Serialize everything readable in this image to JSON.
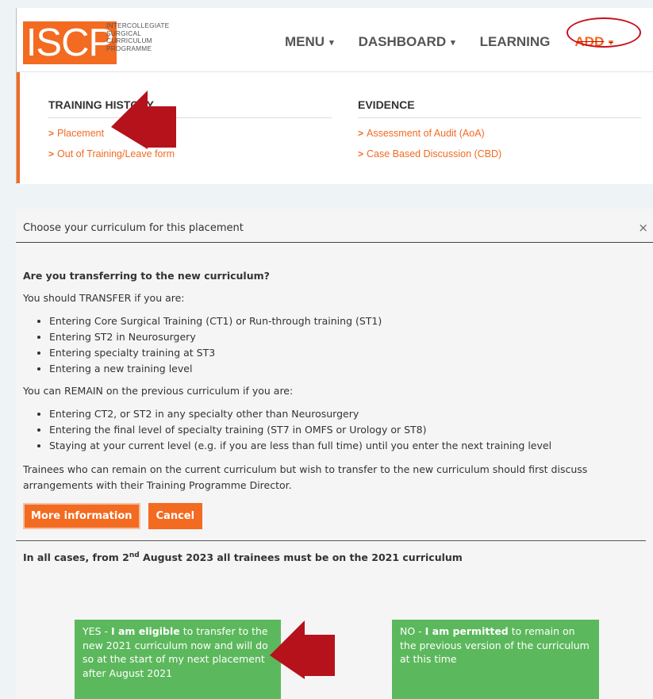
{
  "logo": {
    "short": "ISCP",
    "line1": "INTERCOLLEGIATE",
    "line2": "SURGICAL",
    "line3": "CURRICULUM",
    "line4": "PROGRAMME"
  },
  "nav": {
    "menu": "MENU",
    "dashboard": "DASHBOARD",
    "learning": "LEARNING",
    "add": "ADD",
    "caret": "⌄"
  },
  "dropdown": {
    "training_history": {
      "heading": "TRAINING HISTORY",
      "links": [
        "Placement",
        "Out of Training/Leave form"
      ]
    },
    "evidence": {
      "heading": "EVIDENCE",
      "links": [
        "Assessment of Audit (AoA)",
        "Case Based Discussion (CBD)"
      ]
    },
    "chevron": "›"
  },
  "dialog": {
    "title": "Choose your curriculum for this placement",
    "close": "×",
    "question": "Are you transferring to the new curriculum?",
    "transfer_intro": "You should TRANSFER if you are:",
    "transfer_items": [
      "Entering Core Surgical Training (CT1) or Run-through training (ST1)",
      "Entering ST2 in Neurosurgery",
      "Entering specialty training at ST3",
      "Entering a new training level"
    ],
    "remain_intro": "You can REMAIN on the previous curriculum if you are:",
    "remain_items": [
      "Entering CT2, or ST2 in any specialty other than Neurosurgery",
      "Entering the final level of specialty training (ST7 in OMFS or Urology or ST8)",
      "Staying at your current level (e.g. if you are less than full time) until you enter the next training level"
    ],
    "trainees_note": "Trainees who can remain on the current curriculum but wish to transfer to the new curriculum should first discuss arrangements with their Training Programme Director.",
    "more_info_button": "More information",
    "cancel_button": "Cancel",
    "all_cases_pre": "In all cases, from 2",
    "all_cases_sup": "nd",
    "all_cases_post": " August 2023 all trainees must be on the 2021 curriculum",
    "yes_choice": {
      "pre": "YES - ",
      "bold": "I am eligible",
      "post": " to transfer to the new 2021 curriculum now and will do so at the start of my next placement after August 2021"
    },
    "no_choice": {
      "pre": "NO - ",
      "bold": "I am permitted",
      "post": " to remain on the previous version of the curriculum at this time"
    }
  },
  "colors": {
    "brand_orange": "#f26b21",
    "success_green": "#5cb85c",
    "annotation_red": "#b5121b"
  }
}
